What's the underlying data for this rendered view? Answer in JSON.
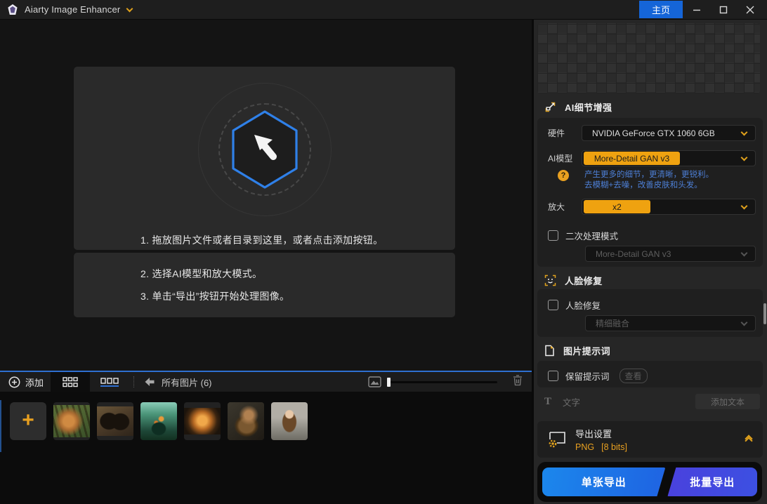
{
  "titlebar": {
    "app_title": "Aiarty Image Enhancer",
    "home_button": "主页"
  },
  "dropzone": {
    "steps": [
      "1. 拖放图片文件或者目录到这里，或者点击添加按钮。",
      "2. 选择AI模型和放大模式。",
      "3. 单击“导出”按钮开始处理图像。"
    ]
  },
  "toolbar": {
    "add_label": "添加",
    "filter_label": "所有图片 (6)"
  },
  "filmstrip": {
    "add_glyph": "+",
    "thumbnails": [
      "tiger",
      "butterfly",
      "terrarium-jar",
      "burger",
      "mech-dog",
      "girl-portrait"
    ]
  },
  "panel": {
    "detail_section": {
      "title": "AI细节增强",
      "hardware_label": "硬件",
      "hardware_value": "NVIDIA GeForce GTX 1060 6GB",
      "model_label": "AI模型",
      "model_value": "More-Detail GAN  v3",
      "help_glyph": "?",
      "model_desc_line1": "产生更多的细节，更清晰，更锐利。",
      "model_desc_line2": "去模糊+去噪，改善皮肤和头发。",
      "upscale_label": "放大",
      "upscale_value": "x2",
      "secondary_label": "二次处理模式",
      "secondary_value": "More-Detail GAN  v3"
    },
    "face_section": {
      "title": "人脸修复",
      "checkbox_label": "人脸修复",
      "blend_value": "精细融合"
    },
    "prompt_section": {
      "title": "图片提示词",
      "keep_label": "保留提示词",
      "view_button": "查看",
      "text_icon_glyph": "T",
      "text_label": "文字",
      "add_text_button": "添加文本"
    },
    "export_section": {
      "title": "导出设置",
      "format": "PNG",
      "bits": "[8 bits]"
    },
    "actions": {
      "single_export": "单张导出",
      "batch_export": "批量导出"
    }
  },
  "colors": {
    "accent_yellow": "#efa210",
    "accent_blue": "#2f80e8",
    "home_button_blue": "#1565d8",
    "single_export_blue": "#1b87ec",
    "batch_export_indigo": "#4a41dd",
    "helper_text_blue": "#4d7fd6"
  },
  "icons": {
    "app_logo": "gem",
    "title_chevron": "chevron-down",
    "window_controls": [
      "minimize",
      "maximize",
      "close"
    ],
    "dropzone_center": "cursor-arrow-in-hexagon",
    "toolbar": [
      "circle-plus",
      "grid-view",
      "list-view",
      "arrow-left",
      "image-size",
      "slider",
      "trash"
    ],
    "sections": [
      "upscale-expand",
      "question-circle",
      "face-detect",
      "document",
      "export-gear",
      "double-chevron-up"
    ]
  }
}
